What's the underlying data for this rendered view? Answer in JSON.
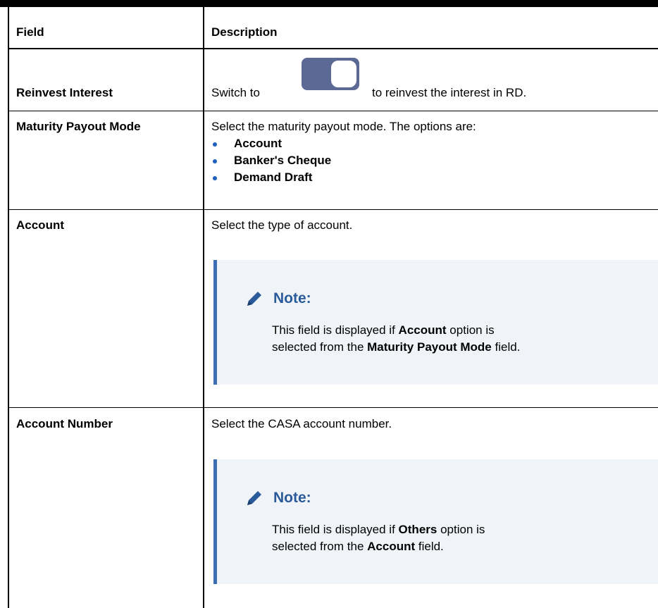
{
  "table": {
    "headers": {
      "field": "Field",
      "description": "Description"
    },
    "rows": [
      {
        "field": "Reinvest Interest",
        "desc_before": "Switch to",
        "desc_after": "to reinvest the interest in RD."
      },
      {
        "field": "Maturity Payout Mode",
        "desc": "Select the maturity payout mode. The options are:",
        "options": [
          "Account",
          "Banker's Cheque",
          "Demand Draft"
        ]
      },
      {
        "field": "Account",
        "desc": "Select the type of account.",
        "note": {
          "title": "Note:",
          "t1": "This field is displayed if",
          "b1": "Account",
          "t2": "option is",
          "t3": "selected from the",
          "b2": "Maturity Payout Mode",
          "t4": "field."
        }
      },
      {
        "field": "Account Number",
        "desc": "Select the CASA account number.",
        "note": {
          "title": "Note:",
          "t1": "This field is displayed if",
          "b1": "Others",
          "t2": "option is",
          "t3": "selected from the",
          "b2": "Account",
          "t4": "field."
        }
      }
    ]
  },
  "colors": {
    "toggle": "#5b6994",
    "note_accent": "#3a6fb5",
    "note_bg": "#f0f4f8",
    "bullet": "#1f5fbf"
  },
  "icons": {
    "toggle": "toggle-switch-icon",
    "note": "pencil-icon"
  }
}
